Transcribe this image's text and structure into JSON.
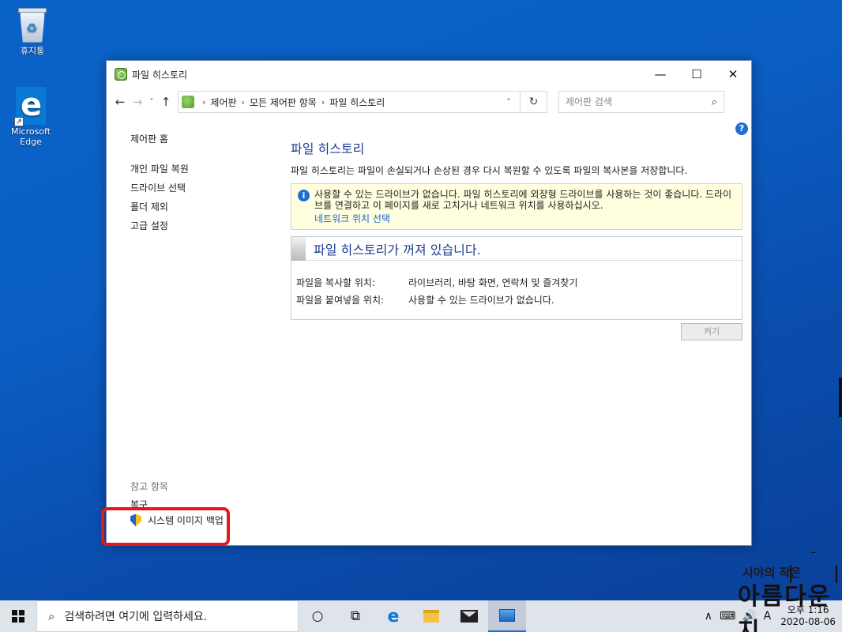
{
  "desktop": {
    "recycle_bin_label": "휴지통",
    "edge_label": "Microsoft Edge"
  },
  "window": {
    "title": "파일 히스토리",
    "controls": {
      "minimize": "—",
      "maximize": "☐",
      "close": "✕"
    }
  },
  "nav": {
    "back": "←",
    "forward": "→",
    "recent": "˅",
    "up": "↑",
    "breadcrumbs": [
      "제어판",
      "모든 제어판 항목",
      "파일 히스토리"
    ],
    "separator": "›",
    "dropdown": "˅",
    "refresh": "↻",
    "search_placeholder": "제어판 검색",
    "search_icon": "⌕",
    "help": "?"
  },
  "left_pane": {
    "home": "제어판 홈",
    "links": [
      "개인 파일 복원",
      "드라이브 선택",
      "폴더 제외",
      "고급 설정"
    ],
    "see_also_header": "참고 항목",
    "restore_link": "복구",
    "system_image_backup": "시스템 이미지 백업"
  },
  "main": {
    "heading": "파일 히스토리",
    "description": "파일 히스토리는 파일이 손실되거나 손상된 경우 다시 복원할 수 있도록 파일의 복사본을 저장합니다.",
    "notice_icon": "i",
    "notice_text": "사용할 수 있는 드라이브가 없습니다. 파일 히스토리에 외장형 드라이브를 사용하는 것이 좋습니다. 드라이브를 연결하고 이 페이지를 새로 고치거나 네트워크 위치를 사용하십시오.",
    "notice_link": "네트워크 위치 선택",
    "status_title": "파일 히스토리가 꺼져 있습니다.",
    "copy_from_label": "파일을 복사할 위치:",
    "copy_from_value": "라이브러리, 바탕 화면, 연락처 및 즐겨찾기",
    "copy_to_label": "파일을 붙여넣을 위치:",
    "copy_to_value": "사용할 수 있는 드라이브가 없습니다.",
    "turn_on_button": "켜기"
  },
  "taskbar": {
    "search_text": "검색하려면 여기에 입력하세요.",
    "search_icon": "⌕",
    "cortana_icon": "○",
    "taskview_icon": "⧉",
    "edge_icon": "e",
    "tray_chevron": "∧",
    "network_icon": "⌨",
    "volume_icon": "🔊",
    "ime": "A",
    "time": "오후 1:16",
    "date": "2020-08-06"
  },
  "watermark": {
    "line1": "시야의 작은",
    "line2": "아름다운 지"
  },
  "colors": {
    "desktop": "#0a5fc5",
    "heading": "#1e3d91",
    "link": "#1a64c8",
    "highlight": "#e8151b",
    "notice_bg": "#ffffe0"
  }
}
